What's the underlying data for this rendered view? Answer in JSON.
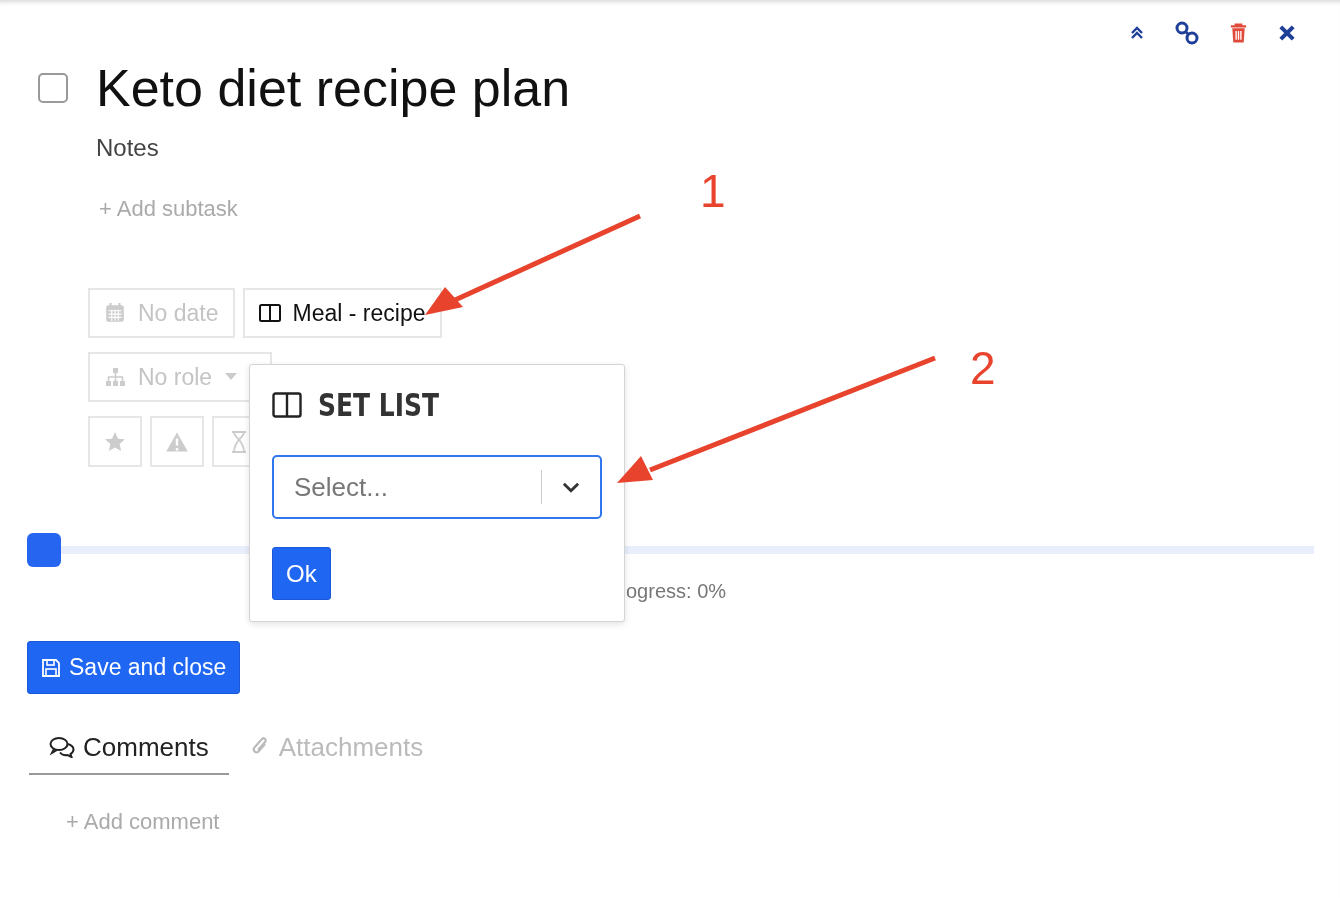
{
  "task": {
    "title": "Keto diet recipe plan",
    "completed": false,
    "notes_label": "Notes",
    "add_subtask": "+ Add subtask"
  },
  "properties": {
    "date": "No date",
    "list": "Meal - recipe",
    "role": "No role"
  },
  "progress": {
    "level": 0,
    "label": "ogress: 0%"
  },
  "save_button": "Save and close",
  "tabs": [
    {
      "label": "Comments",
      "selected": true
    },
    {
      "label": "Attachments",
      "selected": false
    }
  ],
  "add_comment": "+ Add comment",
  "popover": {
    "title": "SET LIST",
    "select": {
      "placeholder": "Select..."
    },
    "ok_button": "Ok"
  },
  "annotations": [
    {
      "label": "1"
    },
    {
      "label": "2"
    }
  ]
}
